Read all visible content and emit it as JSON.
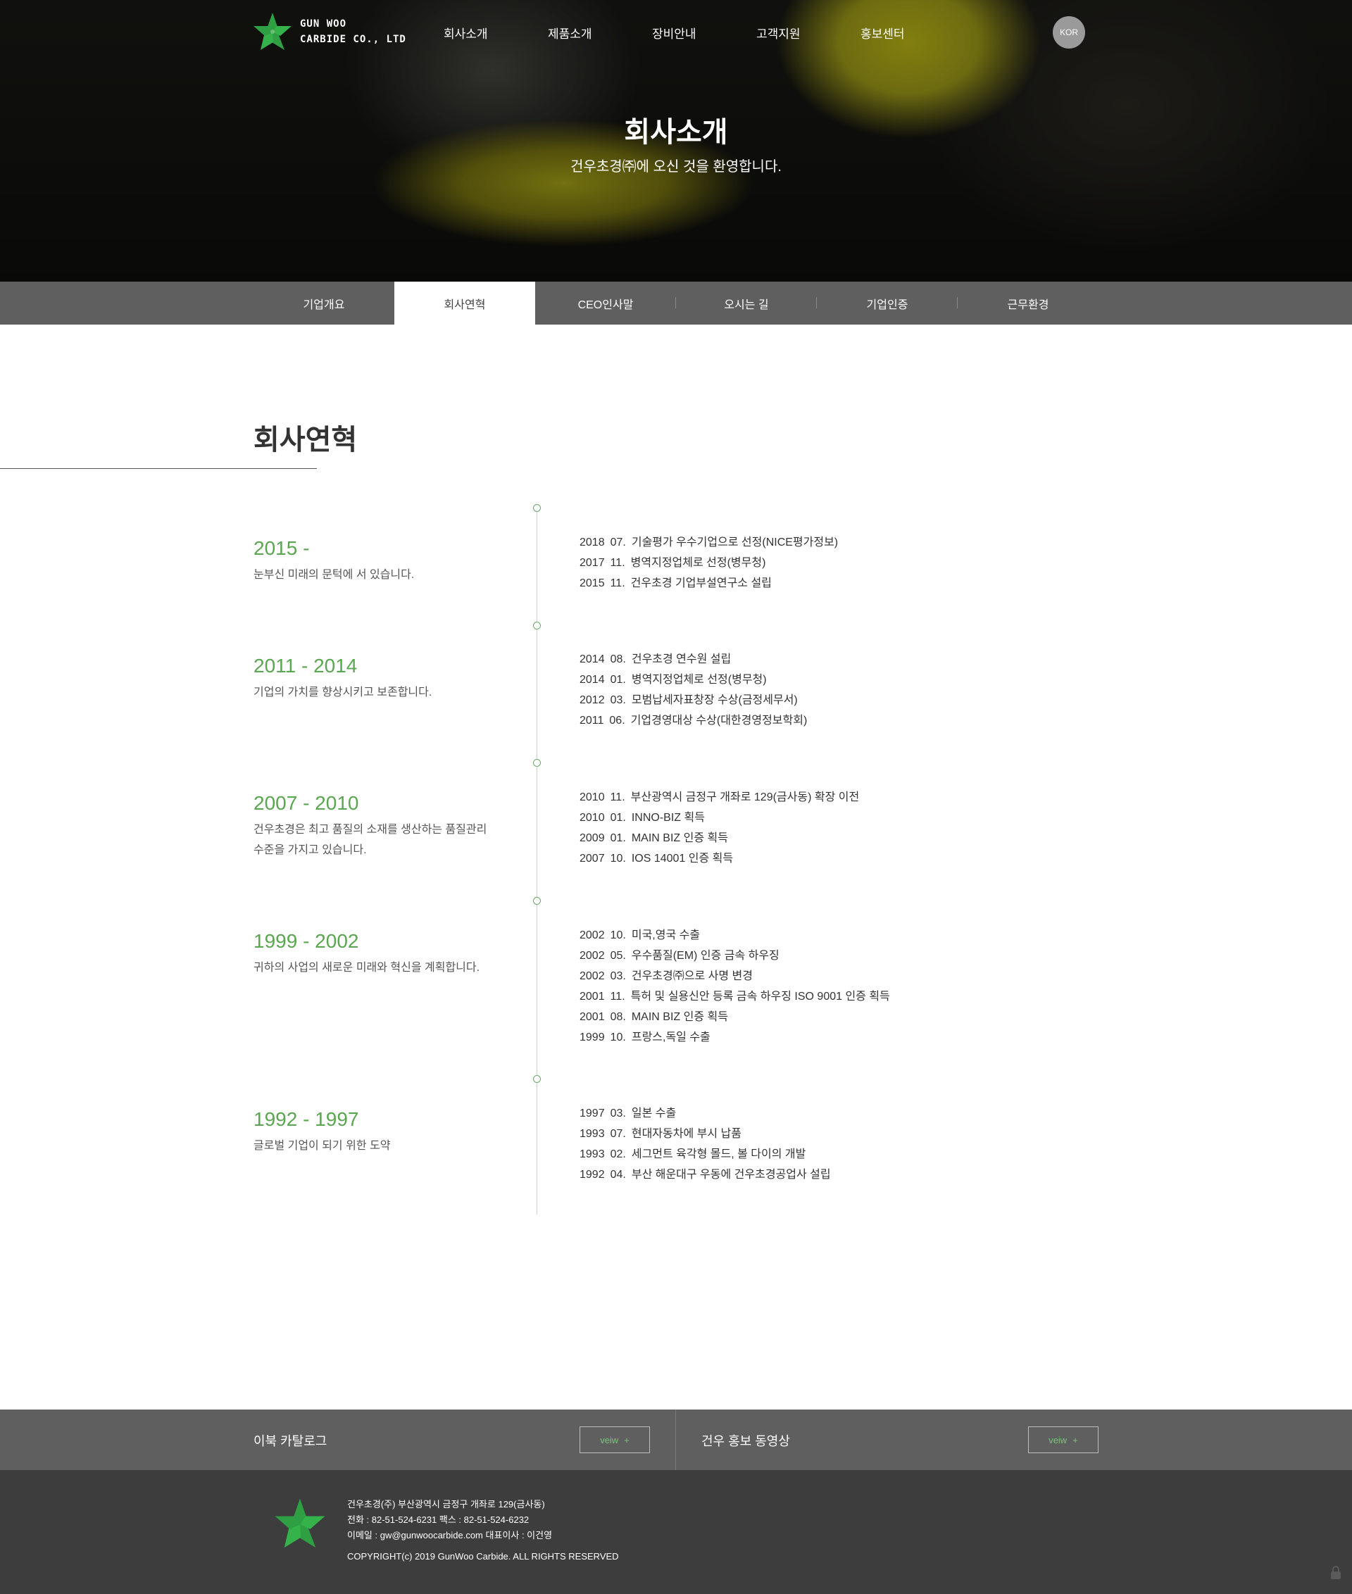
{
  "brand": {
    "line1": "GUN WOO",
    "line2": "CARBIDE CO., LTD"
  },
  "nav": [
    "회사소개",
    "제품소개",
    "장비안내",
    "고객지원",
    "홍보센터"
  ],
  "lang": "KOR",
  "hero": {
    "title": "회사소개",
    "subtitle": "건우초경㈜에 오신 것을 환영합니다."
  },
  "subnav": [
    "기업개요",
    "회사연혁",
    "CEO인사말",
    "오시는 길",
    "기업인증",
    "근무환경"
  ],
  "subnav_active": "회사연혁",
  "section_title": "회사연혁",
  "timeline": [
    {
      "years": "2015 -",
      "desc": "눈부신 미래의 문턱에 서 있습니다.",
      "events": [
        {
          "year": "2018",
          "month": "07.",
          "text": "기술평가 우수기업으로 선정(NICE평가정보)"
        },
        {
          "year": "2017",
          "month": "11.",
          "text": "병역지정업체로 선정(병무청)"
        },
        {
          "year": "2015",
          "month": "11.",
          "text": "건우초경 기업부설연구소 설립"
        }
      ]
    },
    {
      "years": "2011 - 2014",
      "desc": "기업의 가치를 향상시키고 보존합니다.",
      "events": [
        {
          "year": "2014",
          "month": "08.",
          "text": "건우초경 연수원 설립"
        },
        {
          "year": "2014",
          "month": "01.",
          "text": "병역지정업체로 선정(병무청)"
        },
        {
          "year": "2012",
          "month": "03.",
          "text": "모범납세자표창장 수상(금정세무서)"
        },
        {
          "year": "2011",
          "month": "06.",
          "text": "기업경영대상 수상(대한경영정보학회)"
        }
      ]
    },
    {
      "years": "2007 - 2010",
      "desc": "건우초경은 최고 품질의 소재를 생산하는 품질관리 수준을 가지고 있습니다.",
      "events": [
        {
          "year": "2010",
          "month": "11.",
          "text": "부산광역시 금정구 개좌로 129(금사동) 확장 이전"
        },
        {
          "year": "2010",
          "month": "01.",
          "text": "INNO-BIZ 획득"
        },
        {
          "year": "2009",
          "month": "01.",
          "text": "MAIN BIZ 인증 획득"
        },
        {
          "year": "2007",
          "month": "10.",
          "text": "IOS 14001 인증 획득"
        }
      ]
    },
    {
      "years": "1999 - 2002",
      "desc": "귀하의 사업의 새로운 미래와 혁신을 계획합니다.",
      "events": [
        {
          "year": "2002",
          "month": "10.",
          "text": "미국,영국 수출"
        },
        {
          "year": "2002",
          "month": "05.",
          "text": "우수품질(EM) 인증 금속 하우징"
        },
        {
          "year": "2002",
          "month": "03.",
          "text": "건우초경㈜으로 사명 변경"
        },
        {
          "year": "2001",
          "month": "11.",
          "text": "특허 및 실용신안 등록 금속 하우징 ISO 9001 인증 획득"
        },
        {
          "year": "2001",
          "month": "08.",
          "text": "MAIN BIZ 인증 획득"
        },
        {
          "year": "1999",
          "month": "10.",
          "text": "프랑스,독일 수출"
        }
      ]
    },
    {
      "years": "1992 - 1997",
      "desc": "글로벌 기업이 되기 위한 도약",
      "events": [
        {
          "year": "1997",
          "month": "03.",
          "text": "일본 수출"
        },
        {
          "year": "1993",
          "month": "07.",
          "text": "현대자동차에 부시 납품"
        },
        {
          "year": "1993",
          "month": "02.",
          "text": "세그먼트 육각형 몰드, 볼 다이의 개발"
        },
        {
          "year": "1992",
          "month": "04.",
          "text": "부산 해운대구 우동에 건우초경공업사 설립"
        }
      ]
    }
  ],
  "footer_links": [
    {
      "label": "이북 카탈로그",
      "button": "veiw",
      "plus": "+"
    },
    {
      "label": "건우 홍보 동영상",
      "button": "veiw",
      "plus": "+"
    }
  ],
  "footer": {
    "address": "건우초경(주) 부산광역시 금정구 개좌로 129(금사동)",
    "phone": "전화 : 82-51-524-6231 팩스 : 82-51-524-6232",
    "email": "이메일 : gw@gunwoocarbide.com 대표이사 : 이건영",
    "copyright": "COPYRIGHT(c) 2019 GunWoo Carbide. ALL RIGHTS RESERVED"
  },
  "colors": {
    "accent_green": "#5ba650",
    "logo_green": "#2ea043",
    "tab_bar": "#5f5f5f",
    "footer_bg": "#3d3d3d"
  },
  "icons": {
    "logo": "star-leaf-logo-icon",
    "lock": "lock-icon"
  }
}
